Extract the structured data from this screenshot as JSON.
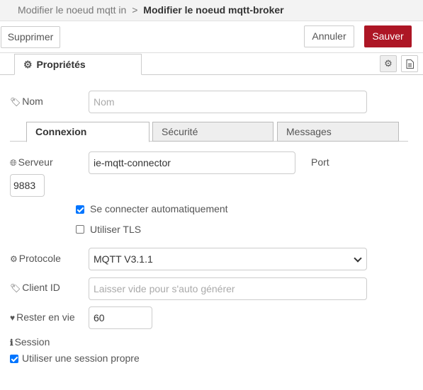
{
  "header": {
    "breadcrumb_prev": "Modifier le noeud mqtt in",
    "breadcrumb_sep": ">",
    "breadcrumb_current": "Modifier le noeud mqtt-broker"
  },
  "toolbar": {
    "delete_label": "Supprimer",
    "cancel_label": "Annuler",
    "save_label": "Sauver"
  },
  "node_tabs": {
    "properties_label": "Propriétés",
    "settings_icon": "gear-icon",
    "description_icon": "file-text-icon"
  },
  "form": {
    "name": {
      "label": "Nom",
      "icon": "tag-icon",
      "value": "",
      "placeholder": "Nom"
    },
    "subtabs": [
      "Connexion",
      "Sécurité",
      "Messages"
    ],
    "server": {
      "label": "Serveur",
      "icon": "globe-icon",
      "value": "ie-mqtt-connector"
    },
    "port": {
      "label": "Port",
      "value": "9883"
    },
    "auto_connect": {
      "label": "Se connecter automatiquement",
      "checked": true
    },
    "use_tls": {
      "label": "Utiliser TLS",
      "checked": false
    },
    "protocol": {
      "label": "Protocole",
      "icon": "gear-icon",
      "value": "MQTT V3.1.1"
    },
    "client_id": {
      "label": "Client ID",
      "icon": "tag-icon",
      "value": "",
      "placeholder": "Laisser vide pour s'auto générer"
    },
    "keepalive": {
      "label": "Rester en vie",
      "icon": "heartbeat-icon",
      "value": "60"
    },
    "session": {
      "label": "Session",
      "icon": "info-icon"
    },
    "clean_session": {
      "label": "Utiliser une session propre",
      "checked": true
    }
  },
  "colors": {
    "save_button": "#ad1625",
    "checkbox_checked": "#0075ff"
  }
}
